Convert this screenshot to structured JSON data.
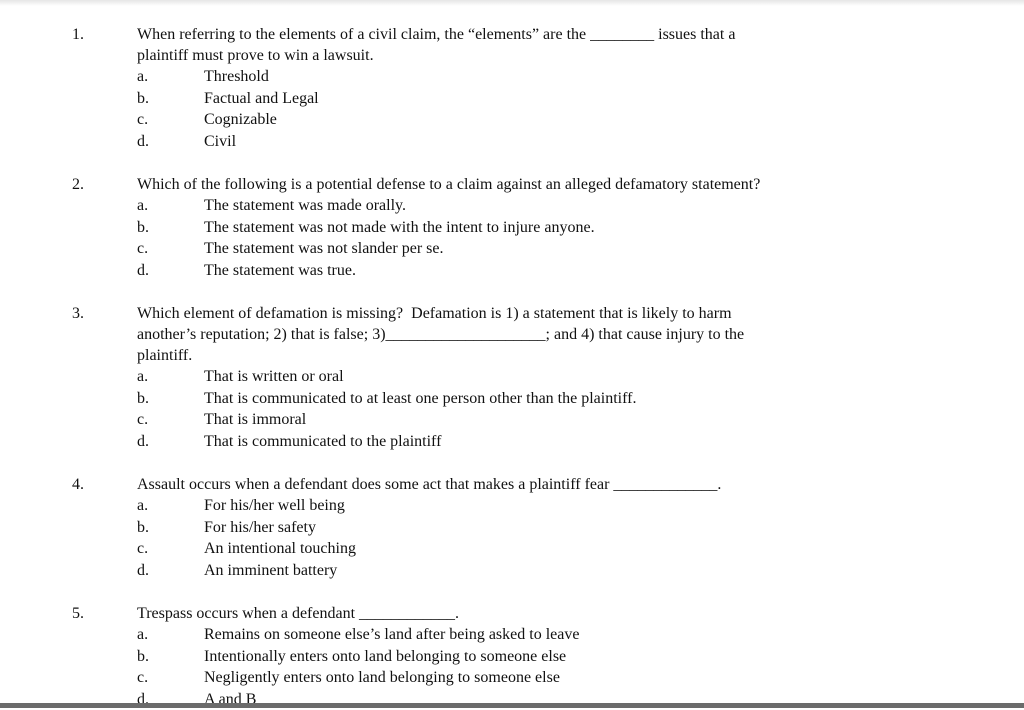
{
  "questions": [
    {
      "number": "1.",
      "text_lines": [
        "When referring to the elements of a civil claim, the “elements” are the ________ issues that a",
        "plaintiff must prove to win a lawsuit."
      ],
      "options": [
        {
          "letter": "a.",
          "text": "Threshold"
        },
        {
          "letter": "b.",
          "text": "Factual and Legal"
        },
        {
          "letter": "c.",
          "text": "Cognizable"
        },
        {
          "letter": "d.",
          "text": "Civil"
        }
      ]
    },
    {
      "number": "2.",
      "text_lines": [
        "Which of the following is a potential defense to a claim against an alleged defamatory statement?"
      ],
      "options": [
        {
          "letter": "a.",
          "text": "The statement was made orally."
        },
        {
          "letter": "b.",
          "text": "The statement was not made with the intent to injure anyone."
        },
        {
          "letter": "c.",
          "text": "The statement was not slander per se."
        },
        {
          "letter": "d.",
          "text": "The statement was true."
        }
      ]
    },
    {
      "number": "3.",
      "text_lines": [
        "Which element of defamation is missing?  Defamation is 1) a statement that is likely to harm",
        "another’s reputation; 2) that is false; 3)____________________; and 4) that cause injury to the",
        "plaintiff."
      ],
      "options": [
        {
          "letter": "a.",
          "text": "That is written or oral"
        },
        {
          "letter": "b.",
          "text": "That is communicated to at least one person other than the plaintiff."
        },
        {
          "letter": "c.",
          "text": "That is immoral"
        },
        {
          "letter": "d.",
          "text": "That is communicated to the plaintiff"
        }
      ]
    },
    {
      "number": "4.",
      "text_lines": [
        "Assault occurs when a defendant does some act that makes a plaintiff fear _____________."
      ],
      "options": [
        {
          "letter": "a.",
          "text": "For his/her well being"
        },
        {
          "letter": "b.",
          "text": "For his/her safety"
        },
        {
          "letter": "c.",
          "text": "An intentional touching"
        },
        {
          "letter": "d.",
          "text": "An imminent battery"
        }
      ]
    },
    {
      "number": "5.",
      "text_lines": [
        "Trespass occurs when a defendant ____________."
      ],
      "options": [
        {
          "letter": "a.",
          "text": "Remains on someone else’s land after being asked to leave"
        },
        {
          "letter": "b.",
          "text": "Intentionally enters onto land belonging to someone else"
        },
        {
          "letter": "c.",
          "text": "Negligently enters onto land belonging to someone else"
        },
        {
          "letter": "d.",
          "text": "A and B"
        }
      ]
    }
  ]
}
